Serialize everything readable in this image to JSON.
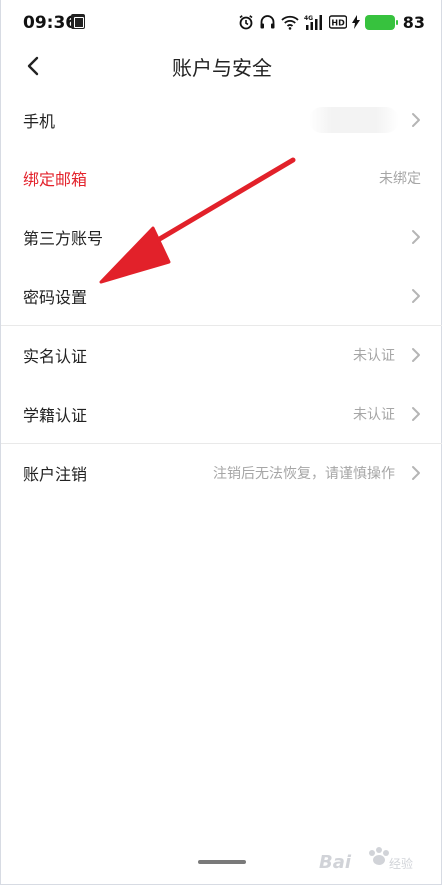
{
  "status_bar": {
    "time": "09:36",
    "battery": "83",
    "icons": [
      "alarm-icon",
      "headphones-icon",
      "wifi-icon",
      "signal-4g-icon",
      "hd-icon",
      "charging-icon",
      "battery-icon"
    ]
  },
  "header": {
    "title": "账户与安全",
    "back_icon": "chevron-left-icon"
  },
  "items": [
    {
      "label": "手机",
      "value": "",
      "value_blurred": true,
      "highlight": false
    },
    {
      "label": "绑定邮箱",
      "value": "未绑定",
      "highlight": true
    },
    {
      "label": "第三方账号",
      "value": "",
      "highlight": false
    },
    {
      "label": "密码设置",
      "value": "",
      "highlight": false
    },
    {
      "label": "实名认证",
      "value": "未认证",
      "highlight": false
    },
    {
      "label": "学籍认证",
      "value": "未认证",
      "highlight": false
    },
    {
      "label": "账户注销",
      "value": "注销后无法恢复，请谨慎操作",
      "highlight": false
    }
  ],
  "colors": {
    "highlight_red": "#e3232c",
    "annotation_arrow": "#e2212a",
    "battery_green": "#37c23e"
  },
  "watermark": {
    "text": "Bai",
    "subtext": "经验"
  }
}
